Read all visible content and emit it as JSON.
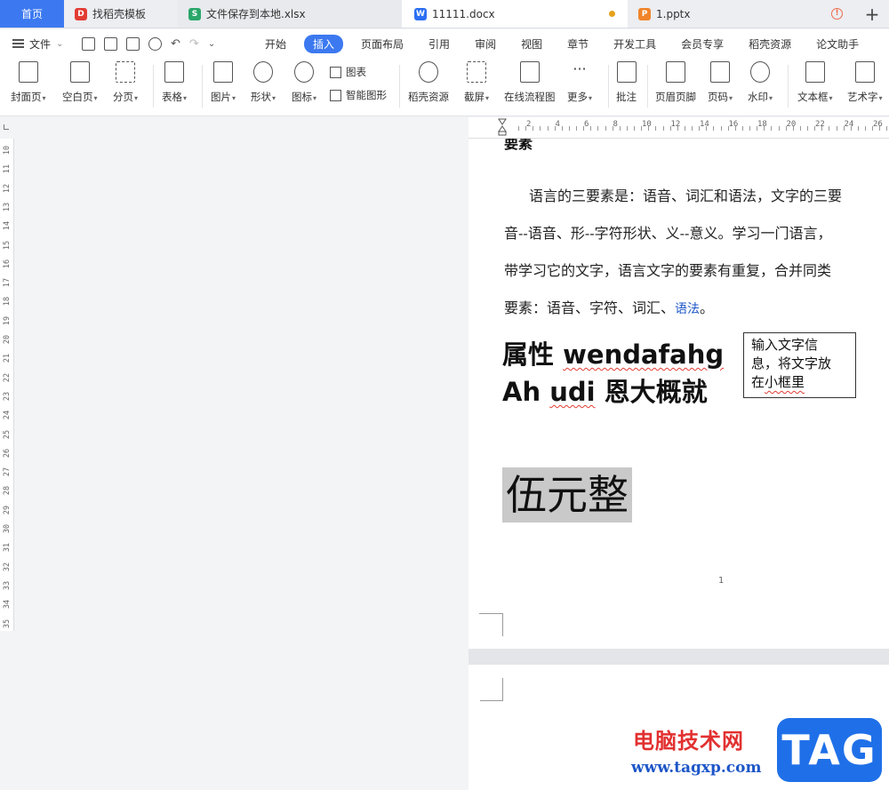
{
  "tabs": {
    "home": "首页",
    "docer": "找稻壳模板",
    "xlsx": "文件保存到本地.xlsx",
    "docx": "11111.docx",
    "pptx": "1.pptx",
    "add": "+"
  },
  "tab_icons": {
    "docer": "D",
    "xlsx": "S",
    "docx": "W",
    "pptx": "P"
  },
  "menubar": {
    "file": "文件",
    "items": [
      "开始",
      "插入",
      "页面布局",
      "引用",
      "审阅",
      "视图",
      "章节",
      "开发工具",
      "会员专享",
      "稻壳资源",
      "论文助手"
    ],
    "active": "插入"
  },
  "ribbon": {
    "cover": "封面页",
    "blank": "空白页",
    "pagebreak": "分页",
    "table": "表格",
    "picture": "图片",
    "shape": "形状",
    "icon": "图标",
    "chart": "图表",
    "smartart": "智能图形",
    "docer_res": "稻壳资源",
    "screenshot": "截屏",
    "flowchart": "在线流程图",
    "more": "更多",
    "comment": "批注",
    "header_footer": "页眉页脚",
    "page_number": "页码",
    "watermark": "水印",
    "textbox": "文本框",
    "wordart": "艺术字"
  },
  "hruler": [
    "2",
    "4",
    "6",
    "8",
    "10",
    "12",
    "14",
    "16",
    "18",
    "20",
    "22",
    "24",
    "26"
  ],
  "vruler": [
    "10",
    "11",
    "12",
    "13",
    "14",
    "15",
    "16",
    "17",
    "18",
    "19",
    "20",
    "21",
    "22",
    "23",
    "24",
    "25",
    "26",
    "27",
    "28",
    "29",
    "30",
    "31",
    "32",
    "33",
    "34",
    "35"
  ],
  "document": {
    "heading": "要素",
    "para_lines": [
      "语言的三要素是：语音、词汇和语法，文字的三要",
      "音--语音、形--字符形状、义--意义。学习一门语言，",
      "带学习它的文字，语言文字的要素有重复，合并同类",
      "要素：语音、字符、词汇、"
    ],
    "para_link": "语法",
    "para_end": "。",
    "title_line1_a": "属性 ",
    "title_line1_b": "wendafahg",
    "title_line2_a": "Ah ",
    "title_line2_b": "udi",
    "title_line2_c": " 恩大概就",
    "textbox_line1": "输入文字信",
    "textbox_line2": "息，将文字放",
    "textbox_line3a": "在",
    "textbox_line3b": "小框里",
    "highlight_text": "伍元整",
    "page_number": "1"
  },
  "watermark": {
    "site_name": "电脑技术网",
    "url": "www.tagxp.com",
    "logo": "TAG"
  }
}
